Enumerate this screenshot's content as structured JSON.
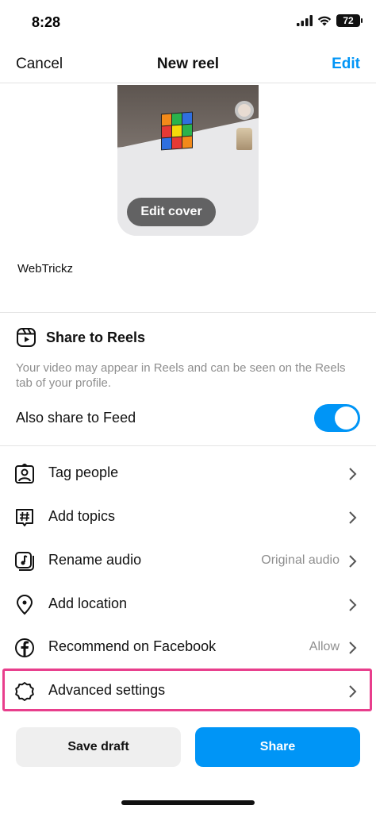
{
  "status_bar": {
    "time": "8:28",
    "battery": "72"
  },
  "nav": {
    "cancel_label": "Cancel",
    "title": "New reel",
    "edit_label": "Edit"
  },
  "cover": {
    "edit_cover_label": "Edit cover"
  },
  "caption": {
    "text": "WebTrickz"
  },
  "share_to_reels": {
    "title": "Share to Reels",
    "description": "Your video may appear in Reels and can be seen on the Reels tab of your profile.",
    "also_share_feed_label": "Also share to Feed",
    "also_share_feed_on": true
  },
  "menu": {
    "items": [
      {
        "label": "Tag people",
        "value": "",
        "icon": "tag-people-icon"
      },
      {
        "label": "Add topics",
        "value": "",
        "icon": "hashtag-icon"
      },
      {
        "label": "Rename audio",
        "value": "Original audio",
        "icon": "audio-icon"
      },
      {
        "label": "Add location",
        "value": "",
        "icon": "location-pin-icon"
      },
      {
        "label": "Recommend on Facebook",
        "value": "Allow",
        "icon": "facebook-icon"
      },
      {
        "label": "Advanced settings",
        "value": "",
        "icon": "settings-gear-icon"
      }
    ]
  },
  "actions": {
    "save_draft_label": "Save draft",
    "share_label": "Share"
  },
  "colors": {
    "accent": "#0095f6",
    "highlight": "#e83e8c",
    "muted_text": "#8e8e8e"
  }
}
